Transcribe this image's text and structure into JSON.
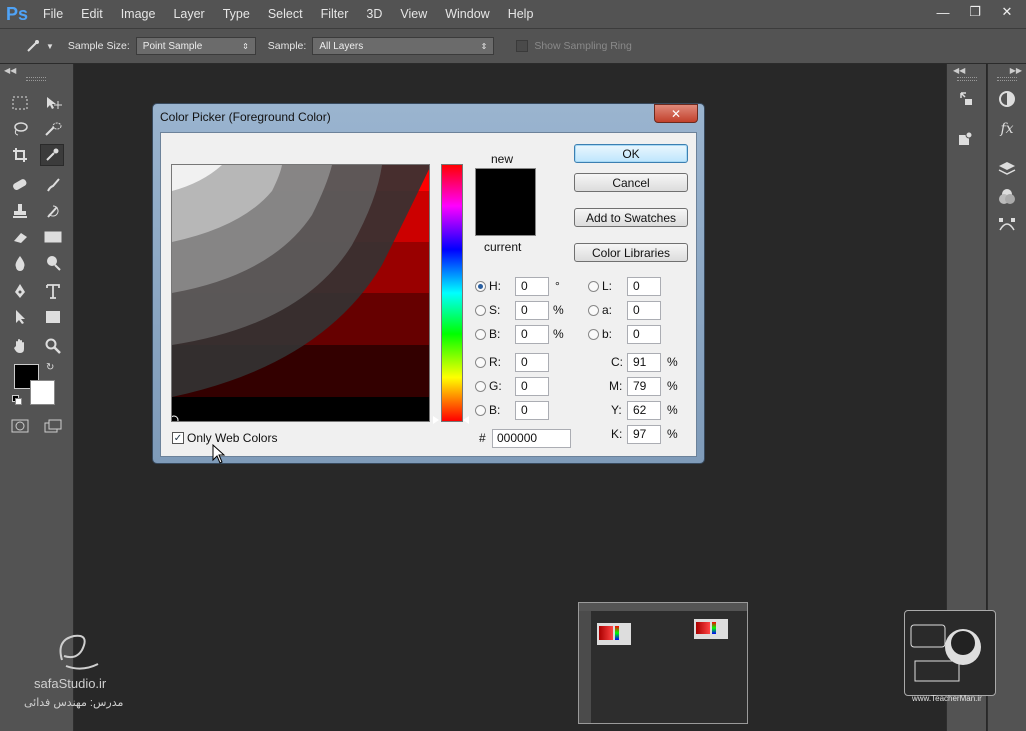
{
  "app": {
    "logo": "Ps",
    "menu": [
      "File",
      "Edit",
      "Image",
      "Layer",
      "Type",
      "Select",
      "Filter",
      "3D",
      "View",
      "Window",
      "Help"
    ],
    "window_controls": [
      "minimize",
      "restore",
      "close"
    ]
  },
  "options_bar": {
    "sample_size_label": "Sample Size:",
    "sample_size_value": "Point Sample",
    "sample_label": "Sample:",
    "sample_value": "All Layers",
    "sampling_ring_label": "Show Sampling Ring"
  },
  "dialog": {
    "title": "Color Picker (Foreground Color)",
    "close_glyph": "✕",
    "new_label": "new",
    "current_label": "current",
    "buttons": {
      "ok": "OK",
      "cancel": "Cancel",
      "add_to_swatches": "Add to Swatches",
      "color_libraries": "Color Libraries"
    },
    "hsb": [
      {
        "label": "H:",
        "value": "0",
        "unit": "°",
        "selected": true
      },
      {
        "label": "S:",
        "value": "0",
        "unit": "%",
        "selected": false
      },
      {
        "label": "B:",
        "value": "0",
        "unit": "%",
        "selected": false
      }
    ],
    "rgb": [
      {
        "label": "R:",
        "value": "0"
      },
      {
        "label": "G:",
        "value": "0"
      },
      {
        "label": "B:",
        "value": "0"
      }
    ],
    "lab": [
      {
        "label": "L:",
        "value": "0"
      },
      {
        "label": "a:",
        "value": "0"
      },
      {
        "label": "b:",
        "value": "0"
      }
    ],
    "cmyk": [
      {
        "label": "C:",
        "value": "91",
        "unit": "%"
      },
      {
        "label": "M:",
        "value": "79",
        "unit": "%"
      },
      {
        "label": "Y:",
        "value": "62",
        "unit": "%"
      },
      {
        "label": "K:",
        "value": "97",
        "unit": "%"
      }
    ],
    "hex_label": "#",
    "hex_value": "000000",
    "only_web_colors_label": "Only Web Colors",
    "only_web_colors_checked": true,
    "new_color": "#000000",
    "hue_color": "#ff0000"
  },
  "foreground_color": "#000000",
  "background_color": "#ffffff",
  "watermarks": {
    "safa": "safaStudio.ir",
    "safa_sub": "مدرس: مهندس فدائی",
    "teacher": "www.TeacherMan.ir"
  }
}
